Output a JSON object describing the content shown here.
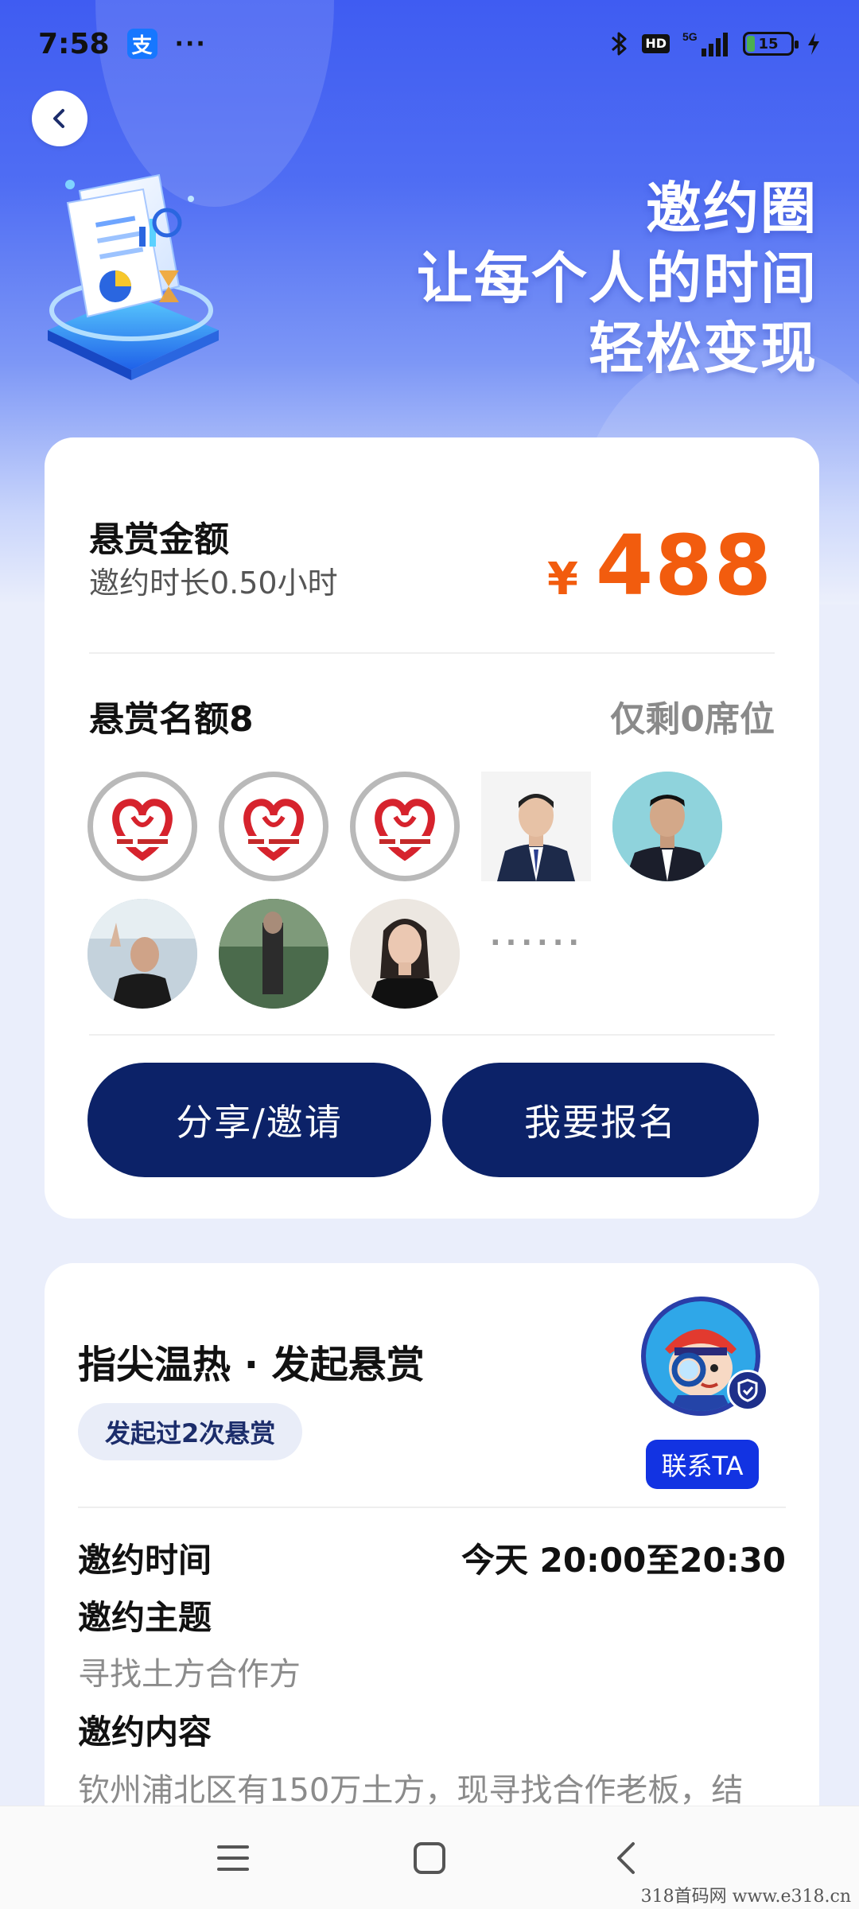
{
  "status_bar": {
    "time": "7:58",
    "app_badge": "支",
    "more": "···",
    "network": "5G",
    "hd": "HD",
    "battery": "15"
  },
  "hero": {
    "line1": "邀约圈",
    "line2": "让每个人的时间",
    "line3": "轻松变现"
  },
  "reward": {
    "title": "悬赏金额",
    "duration": "邀约时长0.50小时",
    "currency": "¥",
    "amount": "488",
    "quota_label": "悬赏名额8",
    "seats_left": "仅剩0席位",
    "more_indicator": "······",
    "share_label": "分享/邀请",
    "signup_label": "我要报名"
  },
  "organizer": {
    "name": "指尖温热 · 发起悬赏",
    "history": "发起过2次悬赏",
    "contact_label": "联系TA"
  },
  "details": {
    "time_label": "邀约时间",
    "time_value": "今天 20:00至20:30",
    "topic_label": "邀约主题",
    "topic_value": "寻找土方合作方",
    "content_label": "邀约内容",
    "content_value": "钦州浦北区有150万土方，现寻找合作老板，结"
  },
  "watermark": "318首码网  www.e318.cn",
  "colors": {
    "hero_blue": "#3f5cf2",
    "price_orange": "#f25c0e",
    "button_navy": "#0c2268",
    "contact_blue": "#1233e2"
  }
}
